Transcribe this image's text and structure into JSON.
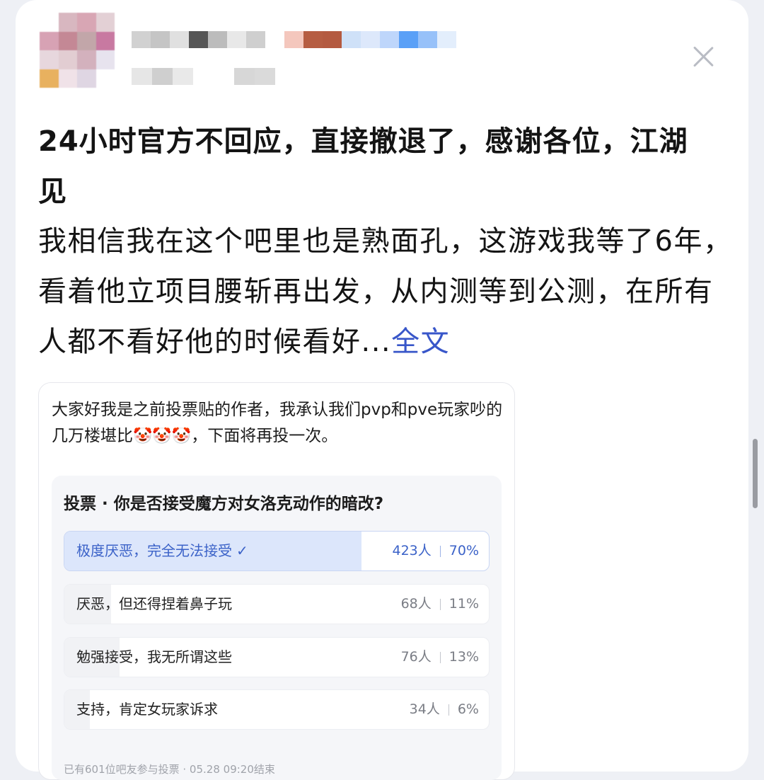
{
  "header": {
    "avatar_colors": [
      "#ffffff",
      "#d8b7c0",
      "#d8a6b4",
      "#e3d0d5",
      "#d7a2b4",
      "#c48895",
      "#c2a6a9",
      "#c879a1",
      "#e7d7dd",
      "#e2cdd2",
      "#d3b1bd",
      "#e7e3ee",
      "#e8b15f",
      "#f0e2e8",
      "#dfd6e3",
      "#ffffff"
    ],
    "name_blur_colors": [
      "#d1d1d1",
      "#c5c5c5",
      "#e0e0e0",
      "#565656",
      "#bcbcbc",
      "#e8e8e8",
      "#cfcfcf",
      "#ffffff",
      "#f4c7bd",
      "#b65d42",
      "#b45a40",
      "#cfe1f8",
      "#dde8fb",
      "#bed6fb",
      "#5aa0f7",
      "#97c1f9",
      "#e3eefc"
    ],
    "meta_blur_colors": [
      "#e6e6e6",
      "#cfcfcf",
      "#e9e9e9",
      "#ffffff",
      "#ffffff",
      "#d7d7d7",
      "#dadada"
    ]
  },
  "post": {
    "title": "24小时官方不回应，直接撤退了，感谢各位，江湖见",
    "body": "我相信我在这个吧里也是熟面孔，这游戏我等了6年，看着他立项目腰斩再出发，从内测等到公测，在所有人都不看好他的时候看好...",
    "more_label": "全文"
  },
  "embed": {
    "text_before_emoji": "大家好我是之前投票贴的作者，我承认我们pvp和pve玩家吵的几万楼堪比",
    "emoji": "🤡🤡🤡",
    "text_after_emoji": "，下面将再投一次。",
    "poll": {
      "title": "投票 · 你是否接受魔方对女洛克动作的暗改?",
      "options": [
        {
          "label": "极度厌恶，完全无法接受",
          "count": "423人",
          "percent": "70%",
          "share": 0.7,
          "selected": true
        },
        {
          "label": "厌恶，但还得捏着鼻子玩",
          "count": "68人",
          "percent": "11%",
          "share": 0.11,
          "selected": false
        },
        {
          "label": "勉强接受，我无所谓这些",
          "count": "76人",
          "percent": "13%",
          "share": 0.13,
          "selected": false
        },
        {
          "label": "支持，肯定女玩家诉求",
          "count": "34人",
          "percent": "6%",
          "share": 0.06,
          "selected": false
        }
      ],
      "footer": "已有601位吧友参与投票 · 05.28 09:20结束"
    }
  },
  "colors": {
    "link": "#3856c9",
    "poll_selected": "#3b62c8"
  }
}
